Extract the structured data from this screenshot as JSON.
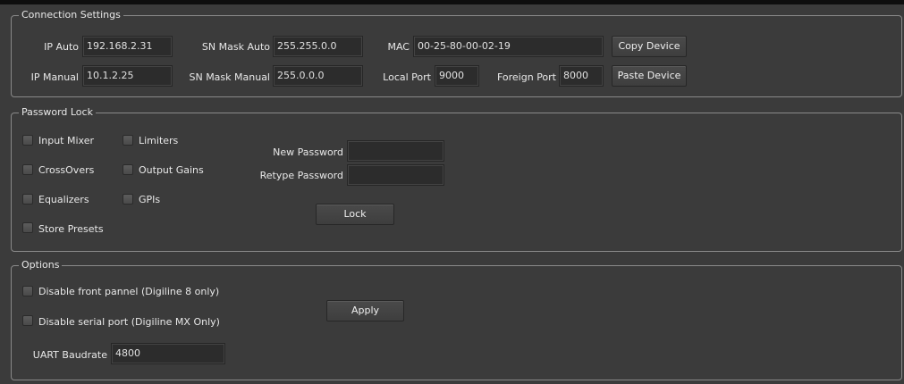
{
  "connection": {
    "legend": "Connection Settings",
    "ip_auto_label": "IP Auto",
    "ip_auto_value": "192.168.2.31",
    "ip_manual_label": "IP Manual",
    "ip_manual_value": "10.1.2.25",
    "sn_mask_auto_label": "SN Mask Auto",
    "sn_mask_auto_value": "255.255.0.0",
    "sn_mask_manual_label": "SN Mask Manual",
    "sn_mask_manual_value": "255.0.0.0",
    "mac_label": "MAC",
    "mac_value": "00-25-80-00-02-19",
    "local_port_label": "Local Port",
    "local_port_value": "9000",
    "foreign_port_label": "Foreign Port",
    "foreign_port_value": "8000",
    "copy_device": "Copy Device",
    "paste_device": "Paste Device"
  },
  "password_lock": {
    "legend": "Password Lock",
    "checkboxes": {
      "input_mixer": "Input Mixer",
      "limiters": "Limiters",
      "crossovers": "CrossOvers",
      "output_gains": "Output Gains",
      "equalizers": "Equalizers",
      "gpis": "GPIs",
      "store_presets": "Store Presets"
    },
    "new_password_label": "New Password",
    "new_password_value": "",
    "retype_password_label": "Retype Password",
    "retype_password_value": "",
    "lock_button": "Lock"
  },
  "options": {
    "legend": "Options",
    "disable_front_panel": "Disable front pannel (Digiline 8 only)",
    "disable_serial_port": "Disable serial port (Digiline MX Only)",
    "uart_label": "UART Baudrate",
    "uart_value": "4800",
    "apply_button": "Apply"
  },
  "colors": {
    "background": "#3b3b3b",
    "field_background": "#2c2c2c",
    "group_border": "#8a8a8a",
    "text": "#e8e8e8"
  }
}
